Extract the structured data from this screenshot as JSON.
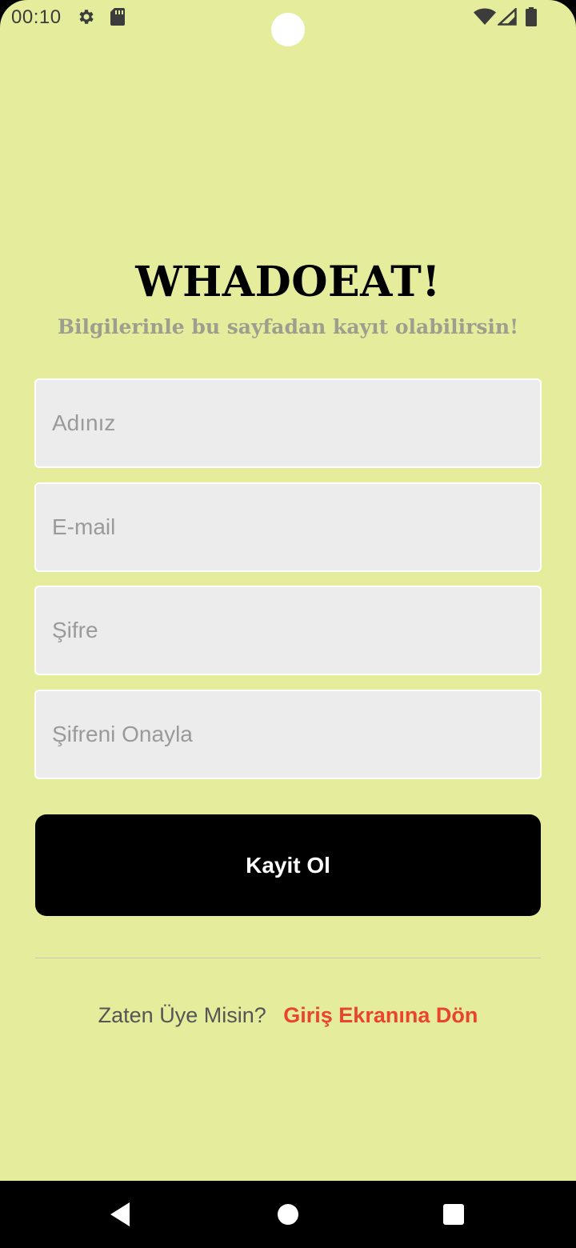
{
  "status_bar": {
    "time": "00:10",
    "icons": [
      "gear-icon",
      "sd-card-icon",
      "wifi-icon",
      "signal-icon",
      "battery-icon"
    ]
  },
  "header": {
    "title": "WHADOEAT!",
    "subtitle": "Bilgilerinle bu sayfadan kayıt olabilirsin!"
  },
  "form": {
    "name": {
      "placeholder": "Adınız",
      "value": ""
    },
    "email": {
      "placeholder": "E-mail",
      "value": ""
    },
    "password": {
      "placeholder": "Şifre",
      "value": ""
    },
    "confirm_password": {
      "placeholder": "Şifreni Onayla",
      "value": ""
    },
    "submit_label": "Kayit Ol"
  },
  "footer": {
    "question": "Zaten Üye Misin?",
    "link_label": "Giriş Ekranına Dön"
  },
  "nav_bar": {
    "buttons": [
      "back-icon",
      "home-icon",
      "recents-icon"
    ]
  },
  "colors": {
    "background": "#e5ec9c",
    "field_background": "#ececec",
    "button_background": "#000000",
    "link": "#e8442e",
    "subtitle": "#9e9e8e"
  }
}
